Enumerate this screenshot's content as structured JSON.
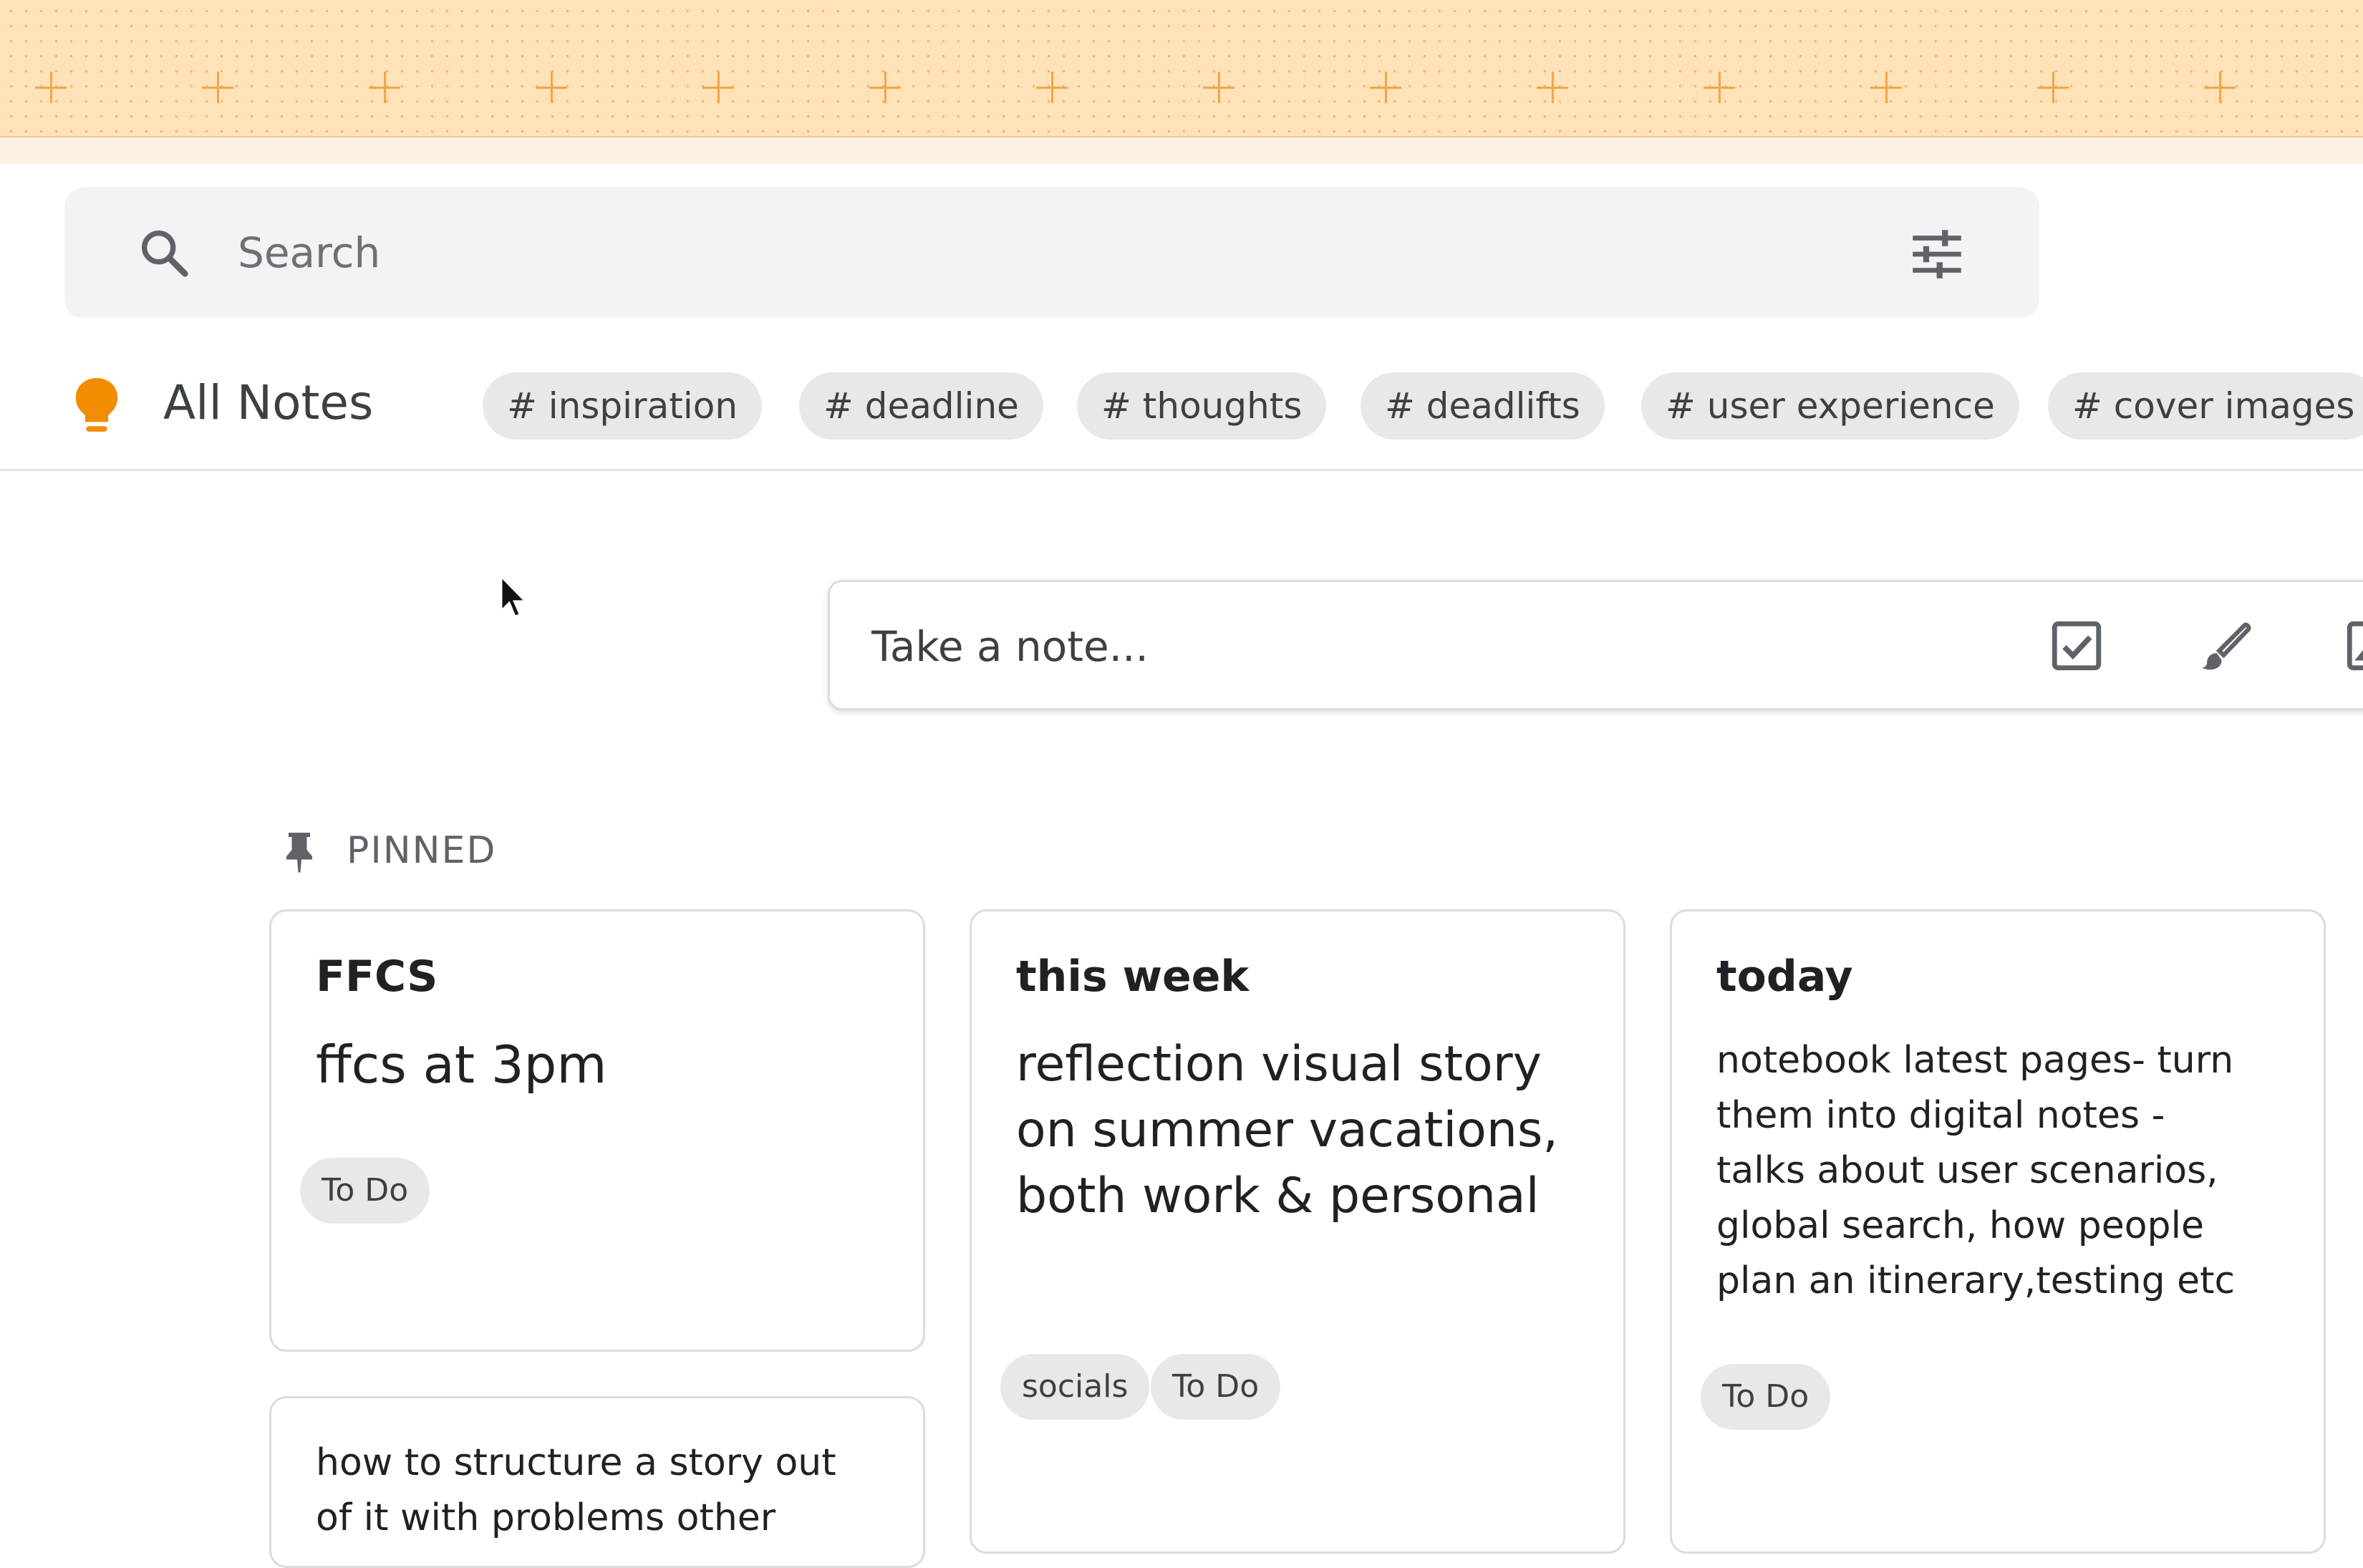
{
  "banner": {
    "accent_color": "#f3a54a",
    "background_color": "#ffe2b7"
  },
  "search": {
    "placeholder": "Search",
    "value": "",
    "search_icon": "search-icon",
    "filter_icon": "tune-sliders-icon"
  },
  "header": {
    "logo_icon": "lightbulb-icon",
    "logo_color": "#f28c00",
    "title": "All Notes",
    "tags": [
      "# inspiration",
      "# deadline",
      "# thoughts",
      "# deadlifts",
      "# user experience",
      "# cover images"
    ]
  },
  "take_note": {
    "placeholder": "Take a note...",
    "tools": [
      "checkbox-icon",
      "brush-icon",
      "image-icon"
    ]
  },
  "pinned": {
    "label": "PINNED",
    "icon": "pin-icon",
    "notes": [
      {
        "title": "FFCS",
        "body": "ffcs at 3pm",
        "labels": [
          "To Do"
        ]
      },
      {
        "title": "this week",
        "body_lines": [
          "reflection visual story",
          "on summer vacations,",
          "both work & personal"
        ],
        "labels": [
          "socials",
          "To Do"
        ]
      },
      {
        "title": "today",
        "body_lines": [
          "notebook latest pages- turn",
          "them into digital notes -",
          "talks about user scenarios,",
          "global search, how people",
          "plan an itinerary,testing etc"
        ],
        "labels": [
          "To Do"
        ]
      },
      {
        "title": "",
        "body_lines": [
          "how to structure a story out",
          "of it with problems other"
        ],
        "labels": []
      }
    ]
  }
}
